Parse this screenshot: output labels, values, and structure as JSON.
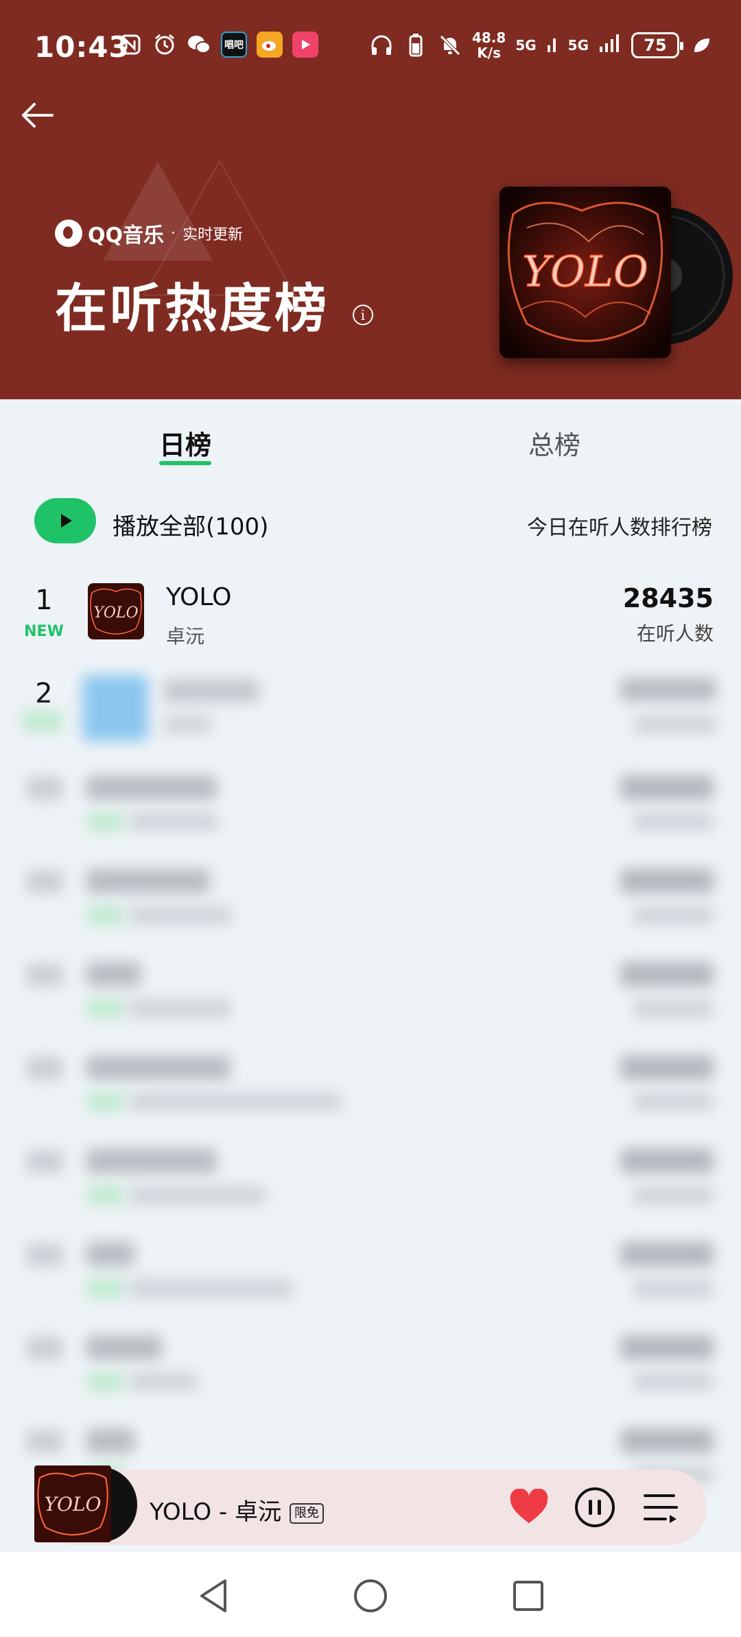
{
  "status_bar": {
    "time": "10:43",
    "net_speed_value": "48.8",
    "net_speed_unit": "K/s",
    "signal_1": "5G",
    "signal_2": "5G",
    "battery": "75",
    "app_icons": [
      "nfc-icon",
      "alarm-icon",
      "wechat-icon",
      "changba-icon",
      "weibo-icon",
      "video-icon"
    ],
    "right_icons": [
      "headphones-icon",
      "battery-small-icon",
      "mute-bell-icon"
    ]
  },
  "header": {
    "brand": "QQ音乐",
    "brand_dot": "·",
    "brand_subtitle": "实时更新",
    "title": "在听热度榜",
    "background_color": "#7f2b21"
  },
  "tabs": [
    {
      "label": "日榜",
      "active": true
    },
    {
      "label": "总榜",
      "active": false
    }
  ],
  "play_all": {
    "label": "播放全部(100)",
    "chart_description": "今日在听人数排行榜"
  },
  "songs": [
    {
      "rank": "1",
      "badge": "NEW",
      "title": "YOLO",
      "artist": "卓沅",
      "count": "28435",
      "count_label": "在听人数"
    },
    {
      "rank": "2"
    }
  ],
  "mini_player": {
    "title": "YOLO - 卓沅",
    "badge": "限免"
  },
  "colors": {
    "accent_green": "#1fc267",
    "heart_red": "#ef3b44",
    "mini_player_bg": "#f2e3e4"
  }
}
